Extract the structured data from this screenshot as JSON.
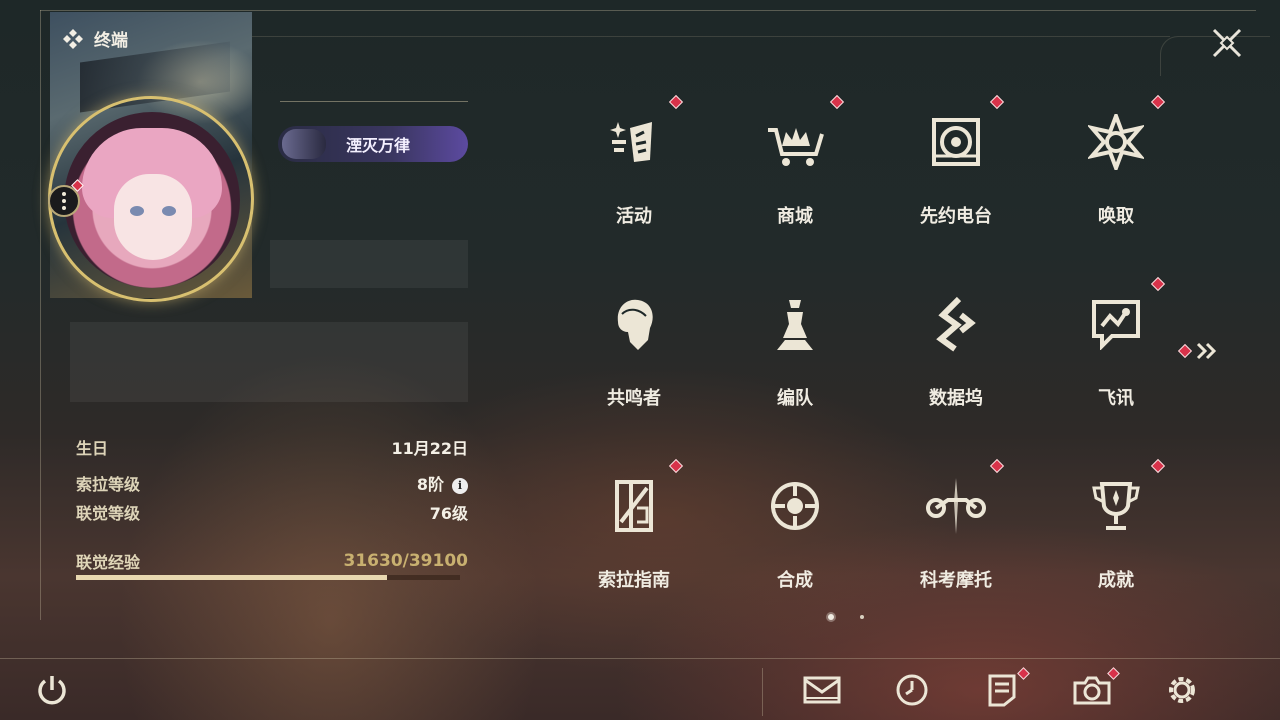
{
  "header": {
    "title": "终端"
  },
  "profile": {
    "title_badge": "湮灭万律",
    "stats": [
      {
        "label": "生日",
        "value": "11月22日"
      },
      {
        "label": "索拉等级",
        "value": "8阶"
      },
      {
        "label": "联觉等级",
        "value": "76级"
      }
    ],
    "exp": {
      "label": "联觉经验",
      "value": "31630/39100",
      "progress": 0.809
    }
  },
  "menu": {
    "items": [
      {
        "label": "活动",
        "icon": "event-icon",
        "notify": true
      },
      {
        "label": "商城",
        "icon": "shop-icon",
        "notify": true
      },
      {
        "label": "先约电台",
        "icon": "radio-icon",
        "notify": true
      },
      {
        "label": "唤取",
        "icon": "convene-icon",
        "notify": true
      },
      {
        "label": "共鸣者",
        "icon": "resonator-icon",
        "notify": false
      },
      {
        "label": "编队",
        "icon": "team-icon",
        "notify": false
      },
      {
        "label": "数据坞",
        "icon": "data-bank-icon",
        "notify": false
      },
      {
        "label": "飞讯",
        "icon": "messenger-icon",
        "notify": true
      },
      {
        "label": "索拉指南",
        "icon": "guidebook-icon",
        "notify": true
      },
      {
        "label": "合成",
        "icon": "synthesis-icon",
        "notify": false
      },
      {
        "label": "科考摩托",
        "icon": "motorcycle-icon",
        "notify": true
      },
      {
        "label": "成就",
        "icon": "trophy-icon",
        "notify": true
      }
    ],
    "page": {
      "current": 1,
      "total": 2
    }
  },
  "bottom_bar": {
    "icons": [
      "power-icon",
      "mail-icon",
      "clock-icon",
      "notice-icon",
      "camera-icon",
      "settings-icon"
    ]
  },
  "colors": {
    "notify": "#d8324a",
    "accent": "#d8c070",
    "text": "#f0ece2"
  }
}
